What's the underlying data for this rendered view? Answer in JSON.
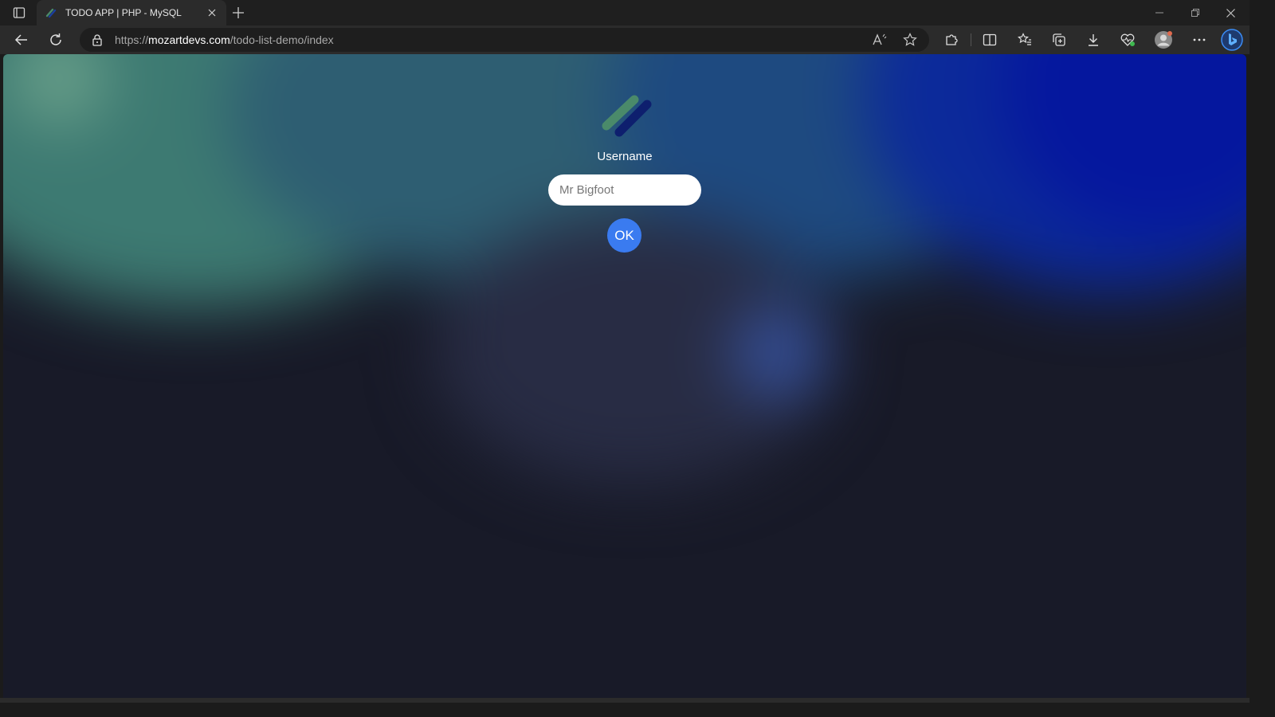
{
  "browser": {
    "tab_title": "TODO APP | PHP - MySQL",
    "url_prefix": "https://",
    "url_host": "mozartdevs.com",
    "url_path": "/todo-list-demo/index"
  },
  "login": {
    "label": "Username",
    "placeholder": "Mr Bigfoot",
    "ok_label": "OK"
  },
  "colors": {
    "accent": "#3a7bf0",
    "logo_green": "#4a8a6a",
    "logo_navy": "#0e1f6e"
  }
}
